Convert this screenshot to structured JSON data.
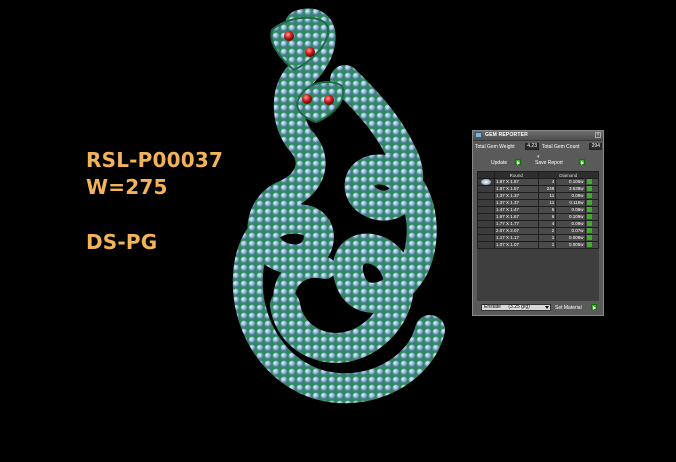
{
  "overlay_text": {
    "sku": "RSL-P00037",
    "weight": "W=275",
    "code": "DS-PG"
  },
  "gem_reporter": {
    "title": "GEM REPORTER",
    "total_gem_weight_label": "Total Gem Weight",
    "total_gem_weight_value": "4.23",
    "total_gem_count_label": "Total Gem Count",
    "total_gem_count_value": "294",
    "update_label": "Update",
    "save_report_label": "Save Report",
    "columns": [
      "Round",
      "Diamond"
    ],
    "rows": [
      {
        "size": "1.87 X 1.87",
        "count": "4",
        "weight": "0.106w"
      },
      {
        "size": "1.57 X 1.57",
        "count": "249",
        "weight": "3.638w"
      },
      {
        "size": "1.37 X 1.37",
        "count": "11",
        "weight": "0.09w"
      },
      {
        "size": "1.37 X 1.37",
        "count": "11",
        "weight": "0.116w"
      },
      {
        "size": "1.47 X 1.47",
        "count": "5",
        "weight": "0.08w"
      },
      {
        "size": "1.67 X 1.67",
        "count": "6",
        "weight": "0.109w"
      },
      {
        "size": "1.77 X 1.77",
        "count": "4",
        "weight": "0.09w"
      },
      {
        "size": "2.07 X 2.07",
        "count": "2",
        "weight": "0.07w"
      },
      {
        "size": "1.17 X 1.17",
        "count": "1",
        "weight": "0.006w"
      },
      {
        "size": "1.07 X 1.07",
        "count": "1",
        "weight": "0.005w"
      }
    ],
    "material_select_value": "Enstate",
    "material_density": "(3.25 g/g)",
    "set_material_label": "Set Material"
  },
  "colors": {
    "overlay_text": "#f2b35a",
    "snake_body": "#2f8a62",
    "gem_fill": "#9cc6dc",
    "eye_color": "#d11a1a",
    "go_button": "#3fae2a",
    "panel_bg": "#5a5a5a"
  }
}
